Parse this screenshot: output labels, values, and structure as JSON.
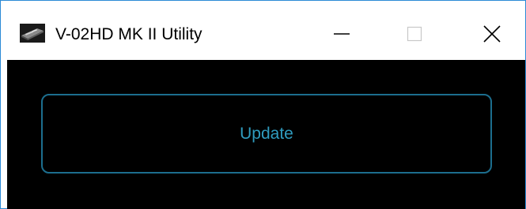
{
  "window": {
    "title": "V-02HD MK II Utility",
    "icon": "device-icon",
    "controls": {
      "minimize_icon": "minimize-icon",
      "maximize_icon": "maximize-icon",
      "close_icon": "close-icon",
      "maximize_enabled": false
    }
  },
  "main": {
    "update_button_label": "Update"
  },
  "colors": {
    "client_background": "#000000",
    "button_border": "#1c6e8e",
    "button_text": "#2f9cbf",
    "window_border": "#2b8ad6"
  }
}
